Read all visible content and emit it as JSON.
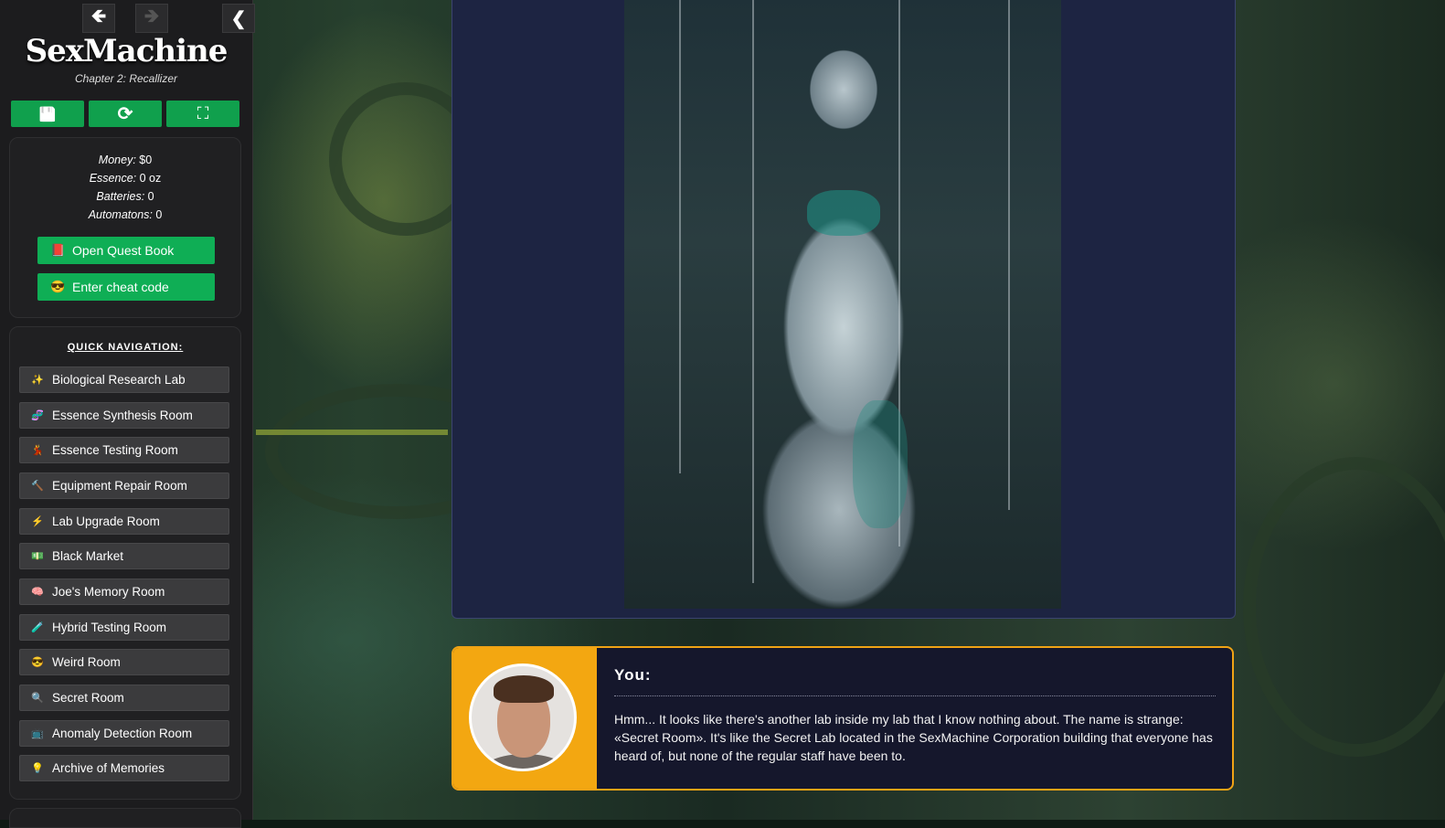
{
  "game": {
    "title": "SexMachine",
    "subtitle": "Chapter 2: Recallizer"
  },
  "header": {
    "back_icon": "🡸",
    "forward_icon": "🡺",
    "collapse_icon": "❮"
  },
  "toolbar": {
    "save_icon": "💾",
    "restart_icon": "⟳",
    "fullscreen_icon": "⛶"
  },
  "stats": {
    "money_label": "Money:",
    "money_value": "$0",
    "essence_label": "Essence:",
    "essence_value": "0 oz",
    "batteries_label": "Batteries:",
    "batteries_value": "0",
    "automatons_label": "Automatons:",
    "automatons_value": "0"
  },
  "actions": {
    "quest_book_icon": "📕",
    "quest_book_label": "Open Quest Book",
    "cheat_icon": "😎",
    "cheat_label": "Enter cheat code"
  },
  "quick_nav": {
    "title": "QUICK NAVIGATION:",
    "items": [
      {
        "icon": "✨",
        "label": "Biological Research Lab"
      },
      {
        "icon": "🧬",
        "label": "Essence Synthesis Room"
      },
      {
        "icon": "💃",
        "label": "Essence Testing Room"
      },
      {
        "icon": "🔨",
        "label": "Equipment Repair Room"
      },
      {
        "icon": "⚡",
        "label": "Lab Upgrade Room"
      },
      {
        "icon": "💵",
        "label": "Black Market"
      },
      {
        "icon": "🧠",
        "label": "Joe's Memory Room"
      },
      {
        "icon": "🧪",
        "label": "Hybrid Testing Room"
      },
      {
        "icon": "😎",
        "label": "Weird Room"
      },
      {
        "icon": "🔍",
        "label": "Secret Room"
      },
      {
        "icon": "📺",
        "label": "Anomaly Detection Room"
      },
      {
        "icon": "💡",
        "label": "Archive of Memories"
      }
    ]
  },
  "dialogue": {
    "speaker": "You:",
    "text": "Hmm... It looks like there's another lab inside my lab that I know nothing about. The name is strange: «Secret Room». It's like the Secret Lab located in the SexMachine Corporation building that everyone has heard of, but none of the regular staff have been to."
  },
  "colors": {
    "accent_green": "#0fae55",
    "dialog_border": "#f0a315",
    "panel_bg": "#1d2442"
  }
}
